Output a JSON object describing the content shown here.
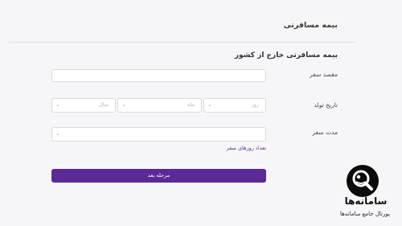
{
  "header": {
    "title": "بیمه مسافرتی"
  },
  "section": {
    "title": "بیمه مسافرتی خارج از کشور"
  },
  "destination": {
    "label": "مقصد سفر",
    "value": ""
  },
  "birthdate": {
    "label": "تاریخ تولد",
    "day_placeholder": "روز",
    "month_placeholder": "ماه",
    "year_placeholder": "سال"
  },
  "duration": {
    "label": "مدت سفر",
    "value": ""
  },
  "days_count_link": "تعداد روزهای سفر",
  "next_button": "مرحله بعد",
  "logo": {
    "name": "سامانه‌ها",
    "tagline": "پورتال جامع سامانه‌ها"
  },
  "colors": {
    "accent": "#5b2a97",
    "background": "#f6f6f8"
  },
  "icons": {
    "select": "chevron-down-icon",
    "logo": "search-magnifier-icon"
  }
}
